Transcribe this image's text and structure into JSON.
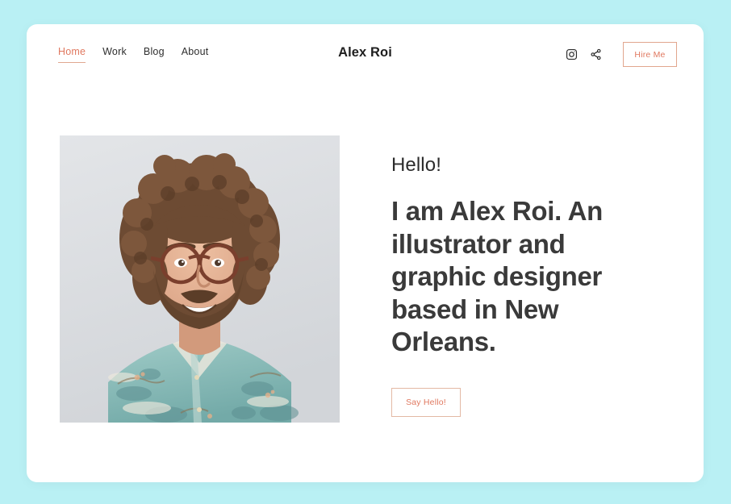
{
  "theme": {
    "page_background": "#b9f0f4",
    "card_background": "#ffffff",
    "accent": "#e0785f",
    "accent_border": "#e1a68e",
    "text_dark": "#2e2e2e",
    "heading": "#3a3a3a"
  },
  "header": {
    "brand": "Alex Roi",
    "nav": [
      {
        "label": "Home",
        "active": true
      },
      {
        "label": "Work",
        "active": false
      },
      {
        "label": "Blog",
        "active": false
      },
      {
        "label": "About",
        "active": false
      }
    ],
    "icons": [
      {
        "name": "instagram-icon"
      },
      {
        "name": "share-icon"
      }
    ],
    "hire_label": "Hire Me"
  },
  "hero": {
    "greeting": "Hello!",
    "headline": "I am Alex Roi. An illustrator and graphic designer based in New Orleans.",
    "cta_label": "Say Hello!",
    "portrait": {
      "alt": "Portrait photo of a smiling man with curly brown hair, a beard and tortoiseshell glasses, wearing a teal floral shirt against a light gray backdrop",
      "colors": {
        "backdrop": "#dcdee1",
        "skin": "#e0ac8d",
        "hair": "#6b4a32",
        "shirt": "#8bbfbd",
        "glasses": "#7a3f2d"
      }
    }
  }
}
